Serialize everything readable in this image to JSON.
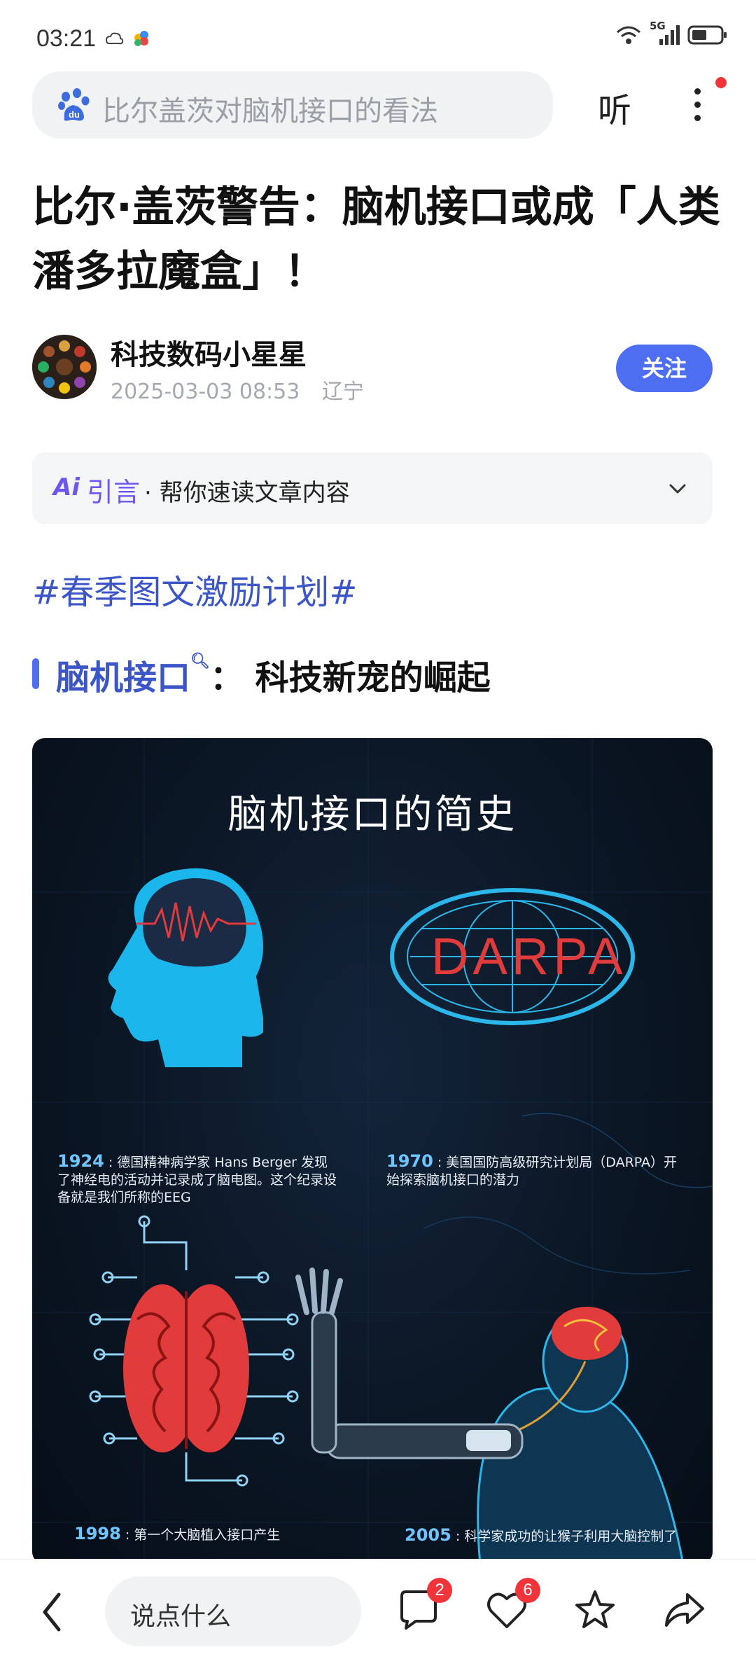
{
  "status_bar": {
    "time": "03:21",
    "network": "5G",
    "icons": [
      "cloud-icon",
      "app-icon",
      "wifi-icon",
      "signal-icon",
      "battery-icon"
    ]
  },
  "search": {
    "query": "比尔盖茨对脑机接口的看法",
    "listen_label": "听"
  },
  "article": {
    "title": "比尔·盖茨警告：脑机接口或成「人类潘多拉魔盒」！",
    "author": {
      "name": "科技数码小星星",
      "datetime": "2025-03-03 08:53",
      "location": "辽宁",
      "follow_label": "关注"
    },
    "ai_summary": {
      "logo": "Ai",
      "label": "引言",
      "text": "· 帮你速读文章内容"
    },
    "hashtag": "#春季图文激励计划#",
    "section": {
      "keyword": "脑机接口",
      "rest": "： 科技新宠的崛起"
    }
  },
  "infographic": {
    "title": "脑机接口的简史",
    "darpa_text": "DARPA",
    "events": [
      {
        "year": "1924",
        "text": "德国精神病学家 Hans Berger 发现了神经电的活动并记录成了脑电图。这个纪录设备就是我们所称的EEG"
      },
      {
        "year": "1970",
        "text": "美国国防高级研究计划局（DARPA）开始探索脑机接口的潜力"
      },
      {
        "year": "1998",
        "text": "第一个大脑植入接口产生"
      },
      {
        "year": "2005",
        "text": "科学家成功的让猴子利用大脑控制了"
      }
    ]
  },
  "bottom_bar": {
    "comment_placeholder": "说点什么",
    "comment_count": "2",
    "like_count": "6"
  },
  "colors": {
    "accent": "#4e6ef2",
    "link": "#3c56c8",
    "ai_purple": "#6b56f0",
    "badge_red": "#f0353a"
  }
}
